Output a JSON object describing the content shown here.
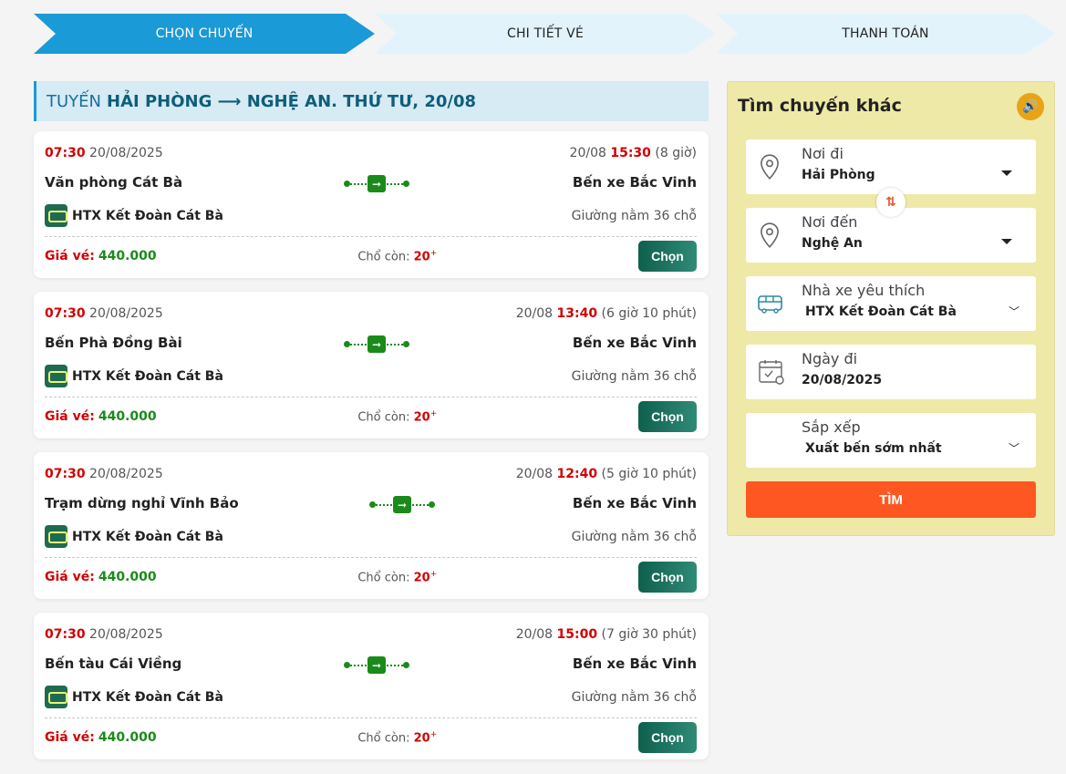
{
  "stepper": {
    "steps": [
      {
        "label": "CHỌN CHUYẾN",
        "active": true
      },
      {
        "label": "CHI TIẾT VÉ",
        "active": false
      },
      {
        "label": "THANH TOÁN",
        "active": false
      }
    ]
  },
  "route_title": {
    "prefix": "TUYẾN",
    "route": "HẢI PHÒNG ⟶ NGHỆ AN",
    "rest": ". THỨ TƯ, 20/08"
  },
  "trips": [
    {
      "depart_time": "07:30",
      "depart_date": "20/08/2025",
      "arrive_date": "20/08",
      "arrive_time": "15:30",
      "duration": "(8 giờ)",
      "from": "Văn phòng Cát Bà",
      "to": "Bến xe Bắc Vinh",
      "operator": "HTX Kết Đoàn Cát Bà",
      "seat_type": "Giường nằm 36 chỗ",
      "price_label": "Giá vé:",
      "price": "440.000",
      "seats_label": "Chổ còn:",
      "seats_left": "20",
      "seats_plus": "+",
      "select_label": "Chọn"
    },
    {
      "depart_time": "07:30",
      "depart_date": "20/08/2025",
      "arrive_date": "20/08",
      "arrive_time": "13:40",
      "duration": "(6 giờ 10 phút)",
      "from": "Bến Phà Đồng Bài",
      "to": "Bến xe Bắc Vinh",
      "operator": "HTX Kết Đoàn Cát Bà",
      "seat_type": "Giường nằm 36 chỗ",
      "price_label": "Giá vé:",
      "price": "440.000",
      "seats_label": "Chổ còn:",
      "seats_left": "20",
      "seats_plus": "+",
      "select_label": "Chọn"
    },
    {
      "depart_time": "07:30",
      "depart_date": "20/08/2025",
      "arrive_date": "20/08",
      "arrive_time": "12:40",
      "duration": "(5 giờ 10 phút)",
      "from": "Trạm dừng nghỉ Vĩnh Bảo",
      "to": "Bến xe Bắc Vinh",
      "operator": "HTX Kết Đoàn Cát Bà",
      "seat_type": "Giường nằm 36 chỗ",
      "price_label": "Giá vé:",
      "price": "440.000",
      "seats_label": "Chổ còn:",
      "seats_left": "20",
      "seats_plus": "+",
      "select_label": "Chọn"
    },
    {
      "depart_time": "07:30",
      "depart_date": "20/08/2025",
      "arrive_date": "20/08",
      "arrive_time": "15:00",
      "duration": "(7 giờ 30 phút)",
      "from": "Bến tàu Cái Viềng",
      "to": "Bến xe Bắc Vinh",
      "operator": "HTX Kết Đoàn Cát Bà",
      "seat_type": "Giường nằm 36 chỗ",
      "price_label": "Giá vé:",
      "price": "440.000",
      "seats_label": "Chổ còn:",
      "seats_left": "20",
      "seats_plus": "+",
      "select_label": "Chọn"
    }
  ],
  "sidebar": {
    "title": "Tìm chuyến khác",
    "from": {
      "label": "Nơi đi",
      "value": "Hải Phòng"
    },
    "to": {
      "label": "Nơi đến",
      "value": "Nghệ An"
    },
    "operator": {
      "label": "Nhà xe yêu thích",
      "value": "HTX Kết Đoàn Cát Bà"
    },
    "date": {
      "label": "Ngày đi",
      "value": "20/08/2025"
    },
    "sort": {
      "label": "Sắp xếp",
      "value": "Xuất bến sớm nhất"
    },
    "search_label": "TÌM"
  },
  "colors": {
    "accent": "#1a9ad6",
    "price": "#1a8a1a",
    "time": "#d10000",
    "search": "#ff5722",
    "sidebar_bg": "#efe9a8"
  }
}
